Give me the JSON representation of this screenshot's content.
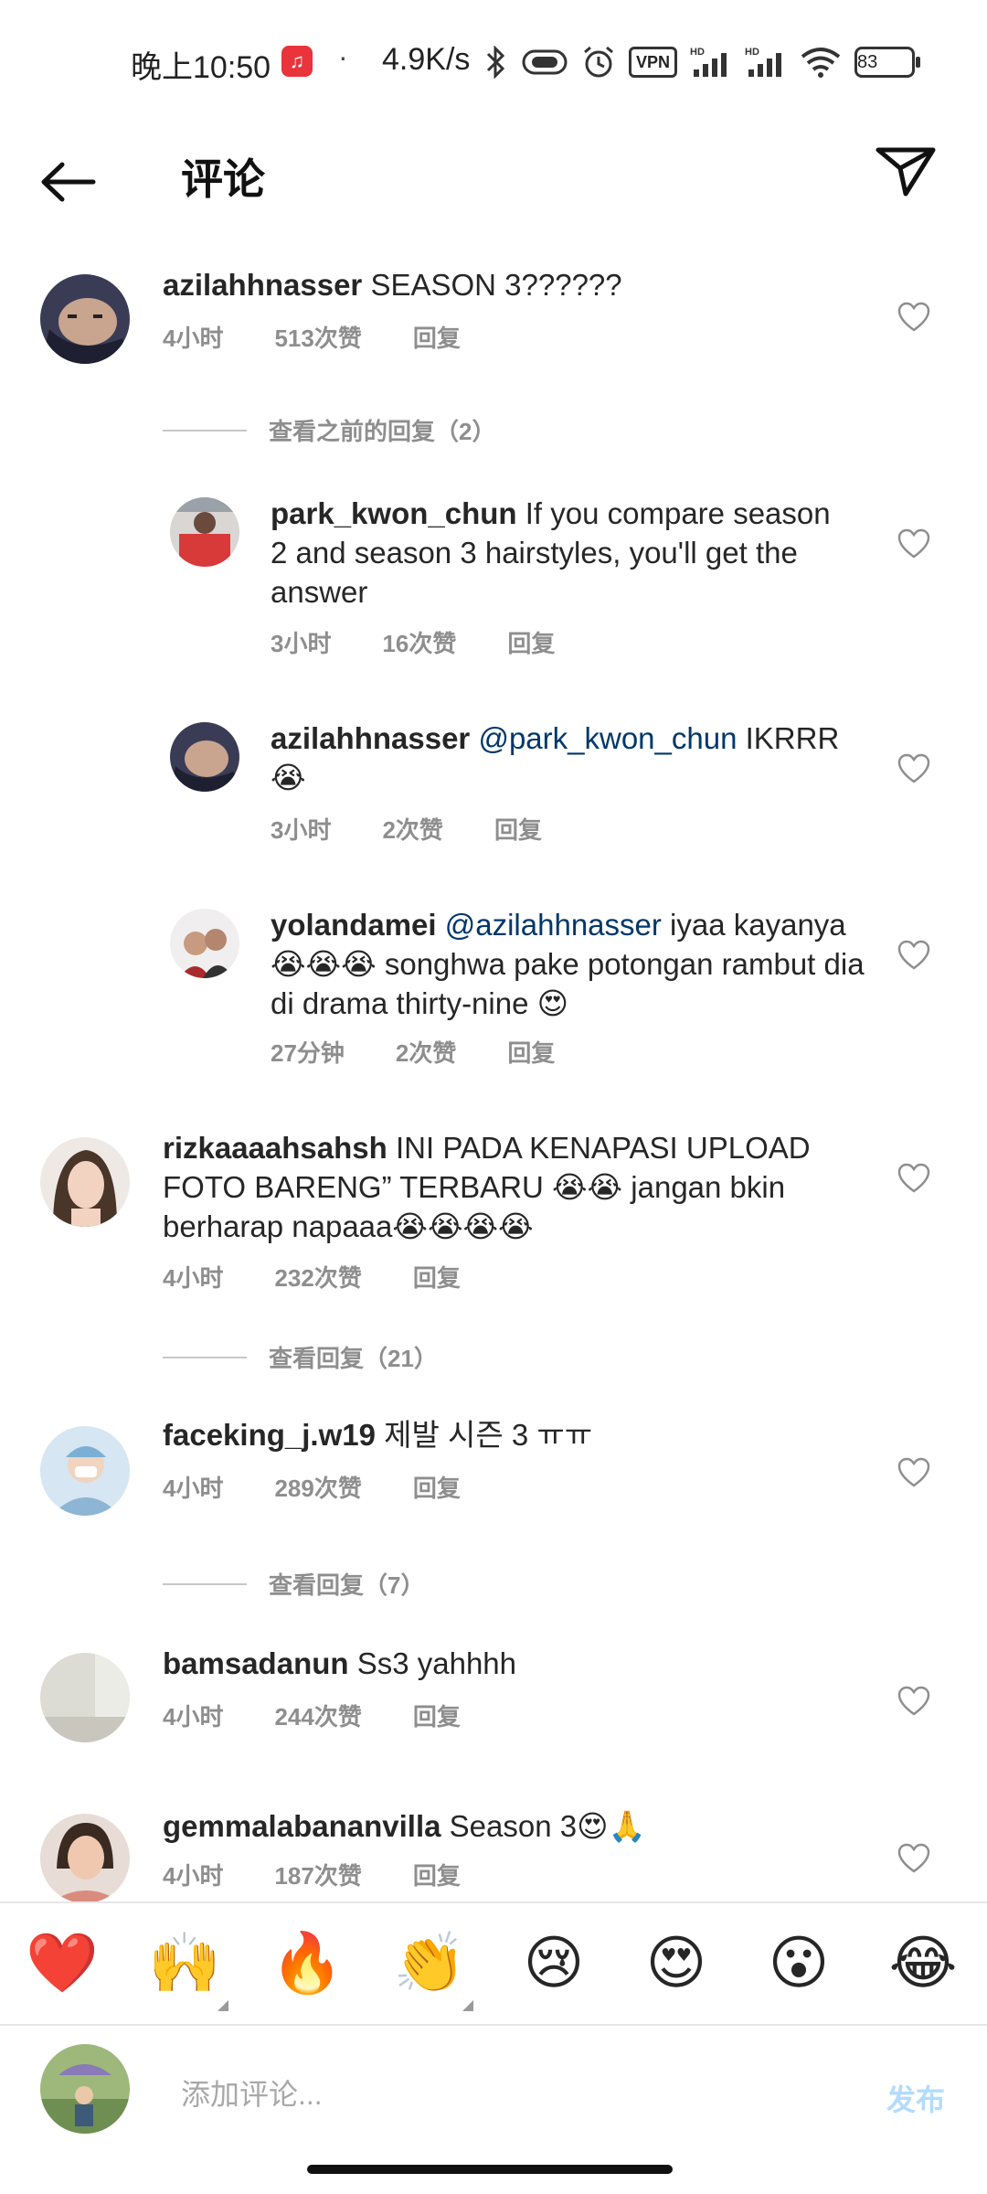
{
  "status_bar": {
    "time": "晚上10:50",
    "dot": "·",
    "speed": "4.9K/s",
    "vpn": "VPN",
    "battery": "83"
  },
  "header": {
    "title": "评论"
  },
  "comments": [
    {
      "username": "azilahhnasser",
      "text": "SEASON 3??????",
      "time": "4小时",
      "likes": "513次赞",
      "reply": "回复"
    },
    {
      "username": "park_kwon_chun",
      "text": "If you compare season 2 and season 3 hairstyles, you'll get the answer",
      "time": "3小时",
      "likes": "16次赞",
      "reply": "回复"
    },
    {
      "username": "azilahhnasser",
      "mention": "@park_kwon_chun",
      "text": "IKRRR 😭",
      "time": "3小时",
      "likes": "2次赞",
      "reply": "回复"
    },
    {
      "username": "yolandamei",
      "mention": "@azilahhnasser",
      "text": "iyaa kayanya 😭😭😭 songhwa pake potongan rambut dia di drama thirty-nine 😍",
      "time": "27分钟",
      "likes": "2次赞",
      "reply": "回复"
    },
    {
      "username": "rizkaaaahsahsh",
      "text": "INI PADA KENAPASI UPLOAD FOTO BARENG” TERBARU 😭😭 jangan bkin berharap napaaa😭😭😭😭",
      "time": "4小时",
      "likes": "232次赞",
      "reply": "回复"
    },
    {
      "username": "faceking_j.w19",
      "text": "제발 시즌 3 ㅠㅠ",
      "time": "4小时",
      "likes": "289次赞",
      "reply": "回复"
    },
    {
      "username": "bamsadanun",
      "text": "Ss3 yahhhh",
      "time": "4小时",
      "likes": "244次赞",
      "reply": "回复"
    },
    {
      "username": "gemmalabananvilla",
      "text": "Season 3😍🙏",
      "time": "4小时",
      "likes": "187次赞",
      "reply": "回复"
    }
  ],
  "view_more": [
    {
      "label": "查看之前的回复（2）"
    },
    {
      "label": "查看回复（21）"
    },
    {
      "label": "查看回复（7）"
    }
  ],
  "emoji_bar": [
    "❤️",
    "🙌",
    "🔥",
    "👏",
    "😢",
    "😍",
    "😮",
    "😂"
  ],
  "composer": {
    "placeholder": "添加评论...",
    "post_label": "发布"
  },
  "colors": {
    "mention": "#00376b",
    "meta": "#8e8e8e",
    "post_disabled": "#b3dbff"
  }
}
